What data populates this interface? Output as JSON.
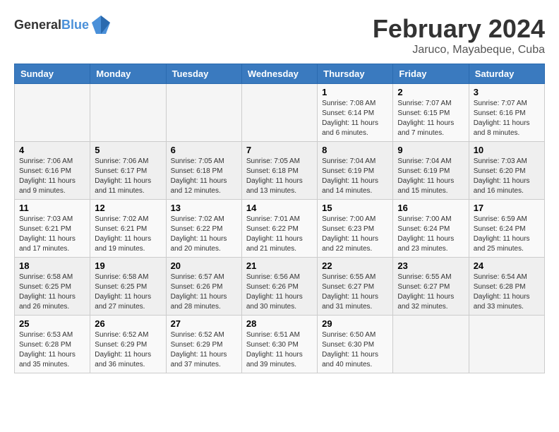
{
  "header": {
    "logo_general": "General",
    "logo_blue": "Blue",
    "month_year": "February 2024",
    "location": "Jaruco, Mayabeque, Cuba"
  },
  "columns": [
    "Sunday",
    "Monday",
    "Tuesday",
    "Wednesday",
    "Thursday",
    "Friday",
    "Saturday"
  ],
  "weeks": [
    [
      {
        "day": "",
        "info": ""
      },
      {
        "day": "",
        "info": ""
      },
      {
        "day": "",
        "info": ""
      },
      {
        "day": "",
        "info": ""
      },
      {
        "day": "1",
        "info": "Sunrise: 7:08 AM\nSunset: 6:14 PM\nDaylight: 11 hours\nand 6 minutes."
      },
      {
        "day": "2",
        "info": "Sunrise: 7:07 AM\nSunset: 6:15 PM\nDaylight: 11 hours\nand 7 minutes."
      },
      {
        "day": "3",
        "info": "Sunrise: 7:07 AM\nSunset: 6:16 PM\nDaylight: 11 hours\nand 8 minutes."
      }
    ],
    [
      {
        "day": "4",
        "info": "Sunrise: 7:06 AM\nSunset: 6:16 PM\nDaylight: 11 hours\nand 9 minutes."
      },
      {
        "day": "5",
        "info": "Sunrise: 7:06 AM\nSunset: 6:17 PM\nDaylight: 11 hours\nand 11 minutes."
      },
      {
        "day": "6",
        "info": "Sunrise: 7:05 AM\nSunset: 6:18 PM\nDaylight: 11 hours\nand 12 minutes."
      },
      {
        "day": "7",
        "info": "Sunrise: 7:05 AM\nSunset: 6:18 PM\nDaylight: 11 hours\nand 13 minutes."
      },
      {
        "day": "8",
        "info": "Sunrise: 7:04 AM\nSunset: 6:19 PM\nDaylight: 11 hours\nand 14 minutes."
      },
      {
        "day": "9",
        "info": "Sunrise: 7:04 AM\nSunset: 6:19 PM\nDaylight: 11 hours\nand 15 minutes."
      },
      {
        "day": "10",
        "info": "Sunrise: 7:03 AM\nSunset: 6:20 PM\nDaylight: 11 hours\nand 16 minutes."
      }
    ],
    [
      {
        "day": "11",
        "info": "Sunrise: 7:03 AM\nSunset: 6:21 PM\nDaylight: 11 hours\nand 17 minutes."
      },
      {
        "day": "12",
        "info": "Sunrise: 7:02 AM\nSunset: 6:21 PM\nDaylight: 11 hours\nand 19 minutes."
      },
      {
        "day": "13",
        "info": "Sunrise: 7:02 AM\nSunset: 6:22 PM\nDaylight: 11 hours\nand 20 minutes."
      },
      {
        "day": "14",
        "info": "Sunrise: 7:01 AM\nSunset: 6:22 PM\nDaylight: 11 hours\nand 21 minutes."
      },
      {
        "day": "15",
        "info": "Sunrise: 7:00 AM\nSunset: 6:23 PM\nDaylight: 11 hours\nand 22 minutes."
      },
      {
        "day": "16",
        "info": "Sunrise: 7:00 AM\nSunset: 6:24 PM\nDaylight: 11 hours\nand 23 minutes."
      },
      {
        "day": "17",
        "info": "Sunrise: 6:59 AM\nSunset: 6:24 PM\nDaylight: 11 hours\nand 25 minutes."
      }
    ],
    [
      {
        "day": "18",
        "info": "Sunrise: 6:58 AM\nSunset: 6:25 PM\nDaylight: 11 hours\nand 26 minutes."
      },
      {
        "day": "19",
        "info": "Sunrise: 6:58 AM\nSunset: 6:25 PM\nDaylight: 11 hours\nand 27 minutes."
      },
      {
        "day": "20",
        "info": "Sunrise: 6:57 AM\nSunset: 6:26 PM\nDaylight: 11 hours\nand 28 minutes."
      },
      {
        "day": "21",
        "info": "Sunrise: 6:56 AM\nSunset: 6:26 PM\nDaylight: 11 hours\nand 30 minutes."
      },
      {
        "day": "22",
        "info": "Sunrise: 6:55 AM\nSunset: 6:27 PM\nDaylight: 11 hours\nand 31 minutes."
      },
      {
        "day": "23",
        "info": "Sunrise: 6:55 AM\nSunset: 6:27 PM\nDaylight: 11 hours\nand 32 minutes."
      },
      {
        "day": "24",
        "info": "Sunrise: 6:54 AM\nSunset: 6:28 PM\nDaylight: 11 hours\nand 33 minutes."
      }
    ],
    [
      {
        "day": "25",
        "info": "Sunrise: 6:53 AM\nSunset: 6:28 PM\nDaylight: 11 hours\nand 35 minutes."
      },
      {
        "day": "26",
        "info": "Sunrise: 6:52 AM\nSunset: 6:29 PM\nDaylight: 11 hours\nand 36 minutes."
      },
      {
        "day": "27",
        "info": "Sunrise: 6:52 AM\nSunset: 6:29 PM\nDaylight: 11 hours\nand 37 minutes."
      },
      {
        "day": "28",
        "info": "Sunrise: 6:51 AM\nSunset: 6:30 PM\nDaylight: 11 hours\nand 39 minutes."
      },
      {
        "day": "29",
        "info": "Sunrise: 6:50 AM\nSunset: 6:30 PM\nDaylight: 11 hours\nand 40 minutes."
      },
      {
        "day": "",
        "info": ""
      },
      {
        "day": "",
        "info": ""
      }
    ]
  ]
}
